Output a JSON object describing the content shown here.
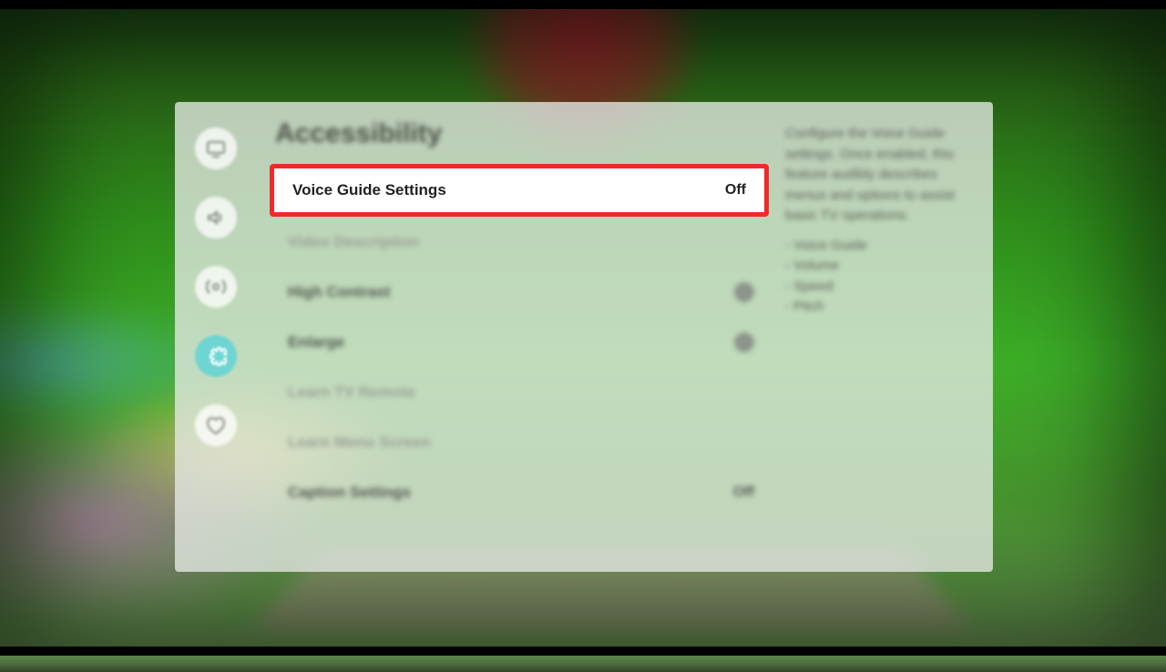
{
  "panel": {
    "title": "Accessibility",
    "sidebar": [
      {
        "name": "picture-icon"
      },
      {
        "name": "sound-icon"
      },
      {
        "name": "broadcast-icon"
      },
      {
        "name": "general-icon",
        "active": true
      },
      {
        "name": "support-icon"
      }
    ],
    "items": [
      {
        "label": "Voice Guide Settings",
        "value": "Off",
        "highlight": true
      },
      {
        "label": "Video Description",
        "disabled": true
      },
      {
        "label": "High Contrast",
        "toggle": true
      },
      {
        "label": "Enlarge",
        "toggle": true
      },
      {
        "label": "Learn TV Remote",
        "disabled": true
      },
      {
        "label": "Learn Menu Screen",
        "disabled": true
      },
      {
        "label": "Caption Settings",
        "value": "Off"
      }
    ],
    "description": {
      "text": "Configure the Voice Guide settings. Once enabled, this feature audibly describes menus and options to assist basic TV operations.",
      "bullets": [
        "Voice Guide",
        "Volume",
        "Speed",
        "Pitch"
      ]
    }
  }
}
